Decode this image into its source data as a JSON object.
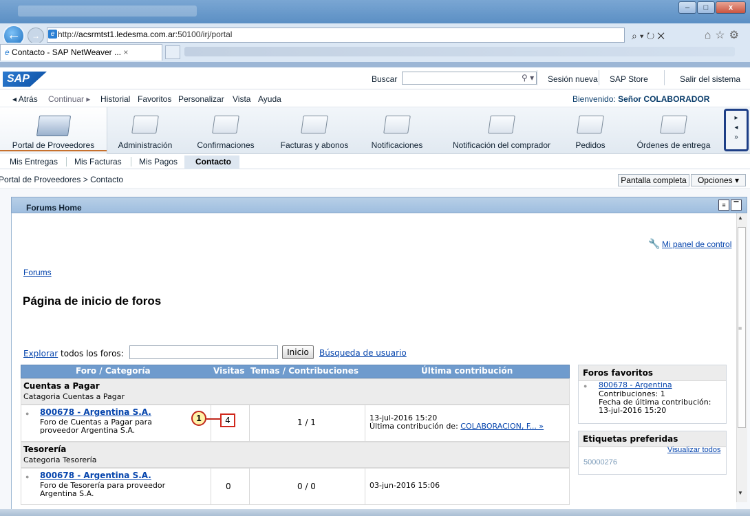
{
  "browser": {
    "url_prefix": "http://",
    "url_domain": "acsrmtst1.ledesma.com.ar",
    "url_rest": ":50100/irj/portal",
    "tab_title": "Contacto - SAP NetWeaver ...",
    "tab_close": "×",
    "window_buttons": [
      "–",
      "□",
      "x"
    ]
  },
  "header": {
    "logo": "SAP",
    "search_label": "Buscar",
    "links": [
      "Sesión nueva",
      "SAP Store",
      "Salir del sistema"
    ]
  },
  "menu": {
    "items": [
      "◂ Atrás",
      "Continuar ▸",
      "Historial",
      "Favoritos",
      "Personalizar",
      "Vista",
      "Ayuda"
    ],
    "welcome_prefix": "Bienvenido:",
    "welcome_user": "Señor COLABORADOR"
  },
  "top_nav": [
    "Portal de Proveedores",
    "Administración",
    "Confirmaciones",
    "Facturas y abonos",
    "Notificaciones",
    "Notificación del comprador",
    "Pedidos",
    "Órdenes de entrega"
  ],
  "second_nav": [
    "Mis Entregas",
    "Mis Facturas",
    "Mis Pagos",
    "Contacto"
  ],
  "breadcrumb": "Portal de Proveedores  >  Contacto",
  "buttons": {
    "full_screen": "Pantalla completa",
    "options": "Opciones ▾"
  },
  "iview": {
    "title": "Forums Home",
    "panel_link": "Mi panel de control",
    "forums_link": "Forums",
    "page_title": "Página de inicio de foros",
    "explore_link": "Explorar",
    "explore_rest": " todos los foros:",
    "inicio_btn": "Inicio",
    "user_search": "Búsqueda de usuario"
  },
  "table": {
    "headers": [
      "Foro / Categoría",
      "Visitas",
      "Temas / Contribuciones",
      "Última contribución"
    ],
    "categories": [
      {
        "title": "Cuentas a Pagar",
        "subtitle": "Catagoria Cuentas a Pagar",
        "forum": {
          "name": "800678 - Argentina S.A.",
          "desc1": "Foro de Cuentas a Pagar para",
          "desc2": "proveedor Argentina S.A.",
          "visits": "4",
          "topics": "1 / 1",
          "last_date": "13-jul-2016 15:20",
          "last_by_prefix": "Última contribución de: ",
          "last_by_link": "COLABORACION, F... »"
        }
      },
      {
        "title": "Tesorería",
        "subtitle": "Categoria Tesorería",
        "forum": {
          "name": "800678 - Argentina S.A.",
          "desc1": "Foro de Tesorería para proveedor",
          "desc2": "Argentina S.A.",
          "visits": "0",
          "topics": "0 / 0",
          "last_date": "03-jun-2016 15:06"
        }
      }
    ],
    "callout_number": "1"
  },
  "favorites": {
    "title": "Foros favoritos",
    "name": "800678 - Argentina",
    "line1": "Contribuciones: 1",
    "line2": "Fecha de última contribución:",
    "line3": "13-jul-2016 15:20"
  },
  "tags": {
    "title": "Etiquetas preferidas",
    "view_all": "Visualizar todos",
    "tag": "50000276"
  }
}
